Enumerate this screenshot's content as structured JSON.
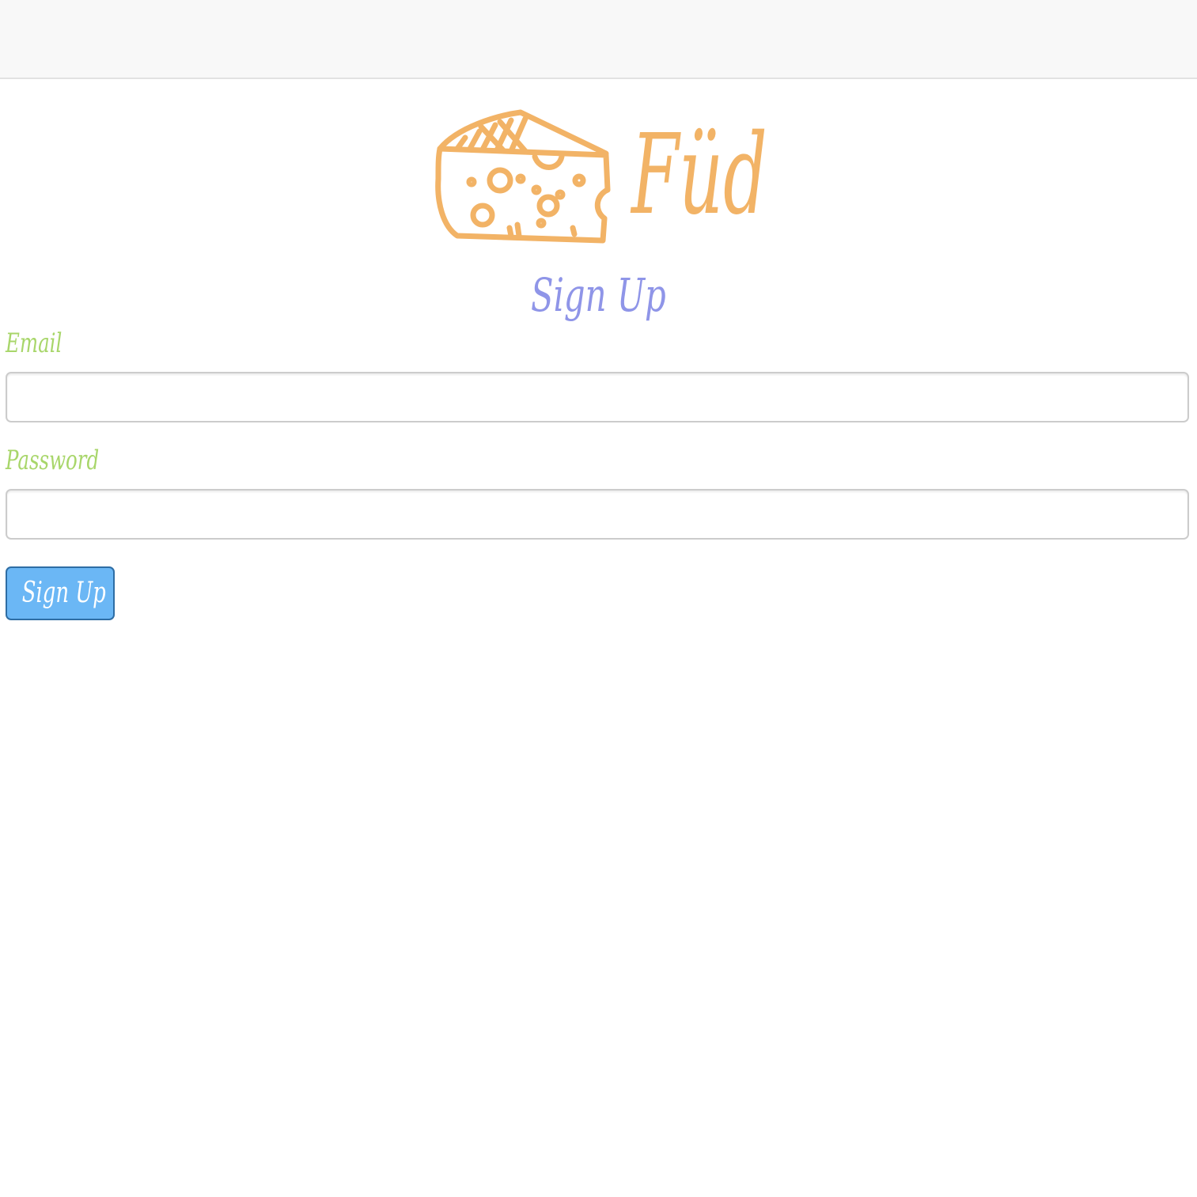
{
  "brand": {
    "name": "Füd",
    "color": "#f2b366"
  },
  "page": {
    "title": "Sign Up"
  },
  "form": {
    "email_label": "Email",
    "email_value": "",
    "password_label": "Password",
    "password_value": "",
    "submit_label": "Sign Up"
  },
  "colors": {
    "title": "#8f95e8",
    "label": "#a8d66a",
    "button": "#6bb7f5",
    "button_border": "#2e6da4"
  }
}
